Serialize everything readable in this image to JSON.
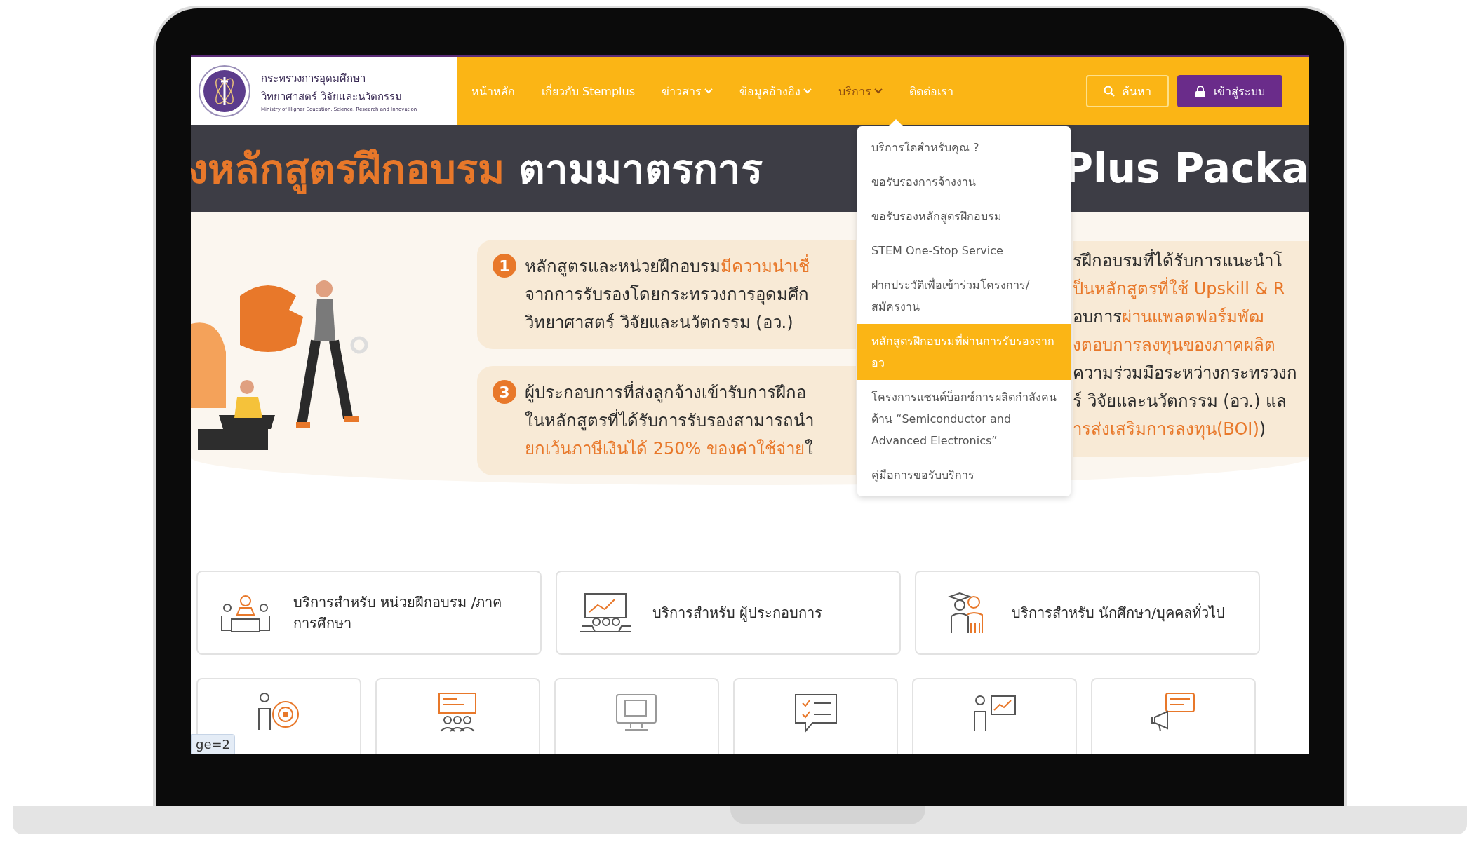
{
  "logo": {
    "line_1": "กระทรวงการอุดมศึกษา",
    "line_2": "วิทยาศาสตร์ วิจัยและนวัตกรรม",
    "line_3": "Ministry of Higher Education, Science, Research and Innovation"
  },
  "nav": [
    {
      "label": "หน้าหลัก",
      "dropdown": false,
      "selected": false
    },
    {
      "label": "เกี่ยวกับ Stemplus",
      "dropdown": false,
      "selected": false
    },
    {
      "label": "ข่าวสาร",
      "dropdown": true,
      "selected": false
    },
    {
      "label": "ข้อมูลอ้างอิง",
      "dropdown": true,
      "selected": false
    },
    {
      "label": "บริการ",
      "dropdown": true,
      "selected": true
    },
    {
      "label": "ติดต่อเรา",
      "dropdown": false,
      "selected": false
    }
  ],
  "search_button": "ค้นหา",
  "login_button": "เข้าสู่ระบบ",
  "banner": {
    "title": [
      {
        "text": "งหลักสูตรฝึกอบรม",
        "highlight": true
      },
      {
        "text": " ตามมาตรการ",
        "highlight": false
      }
    ],
    "title_right": "Plus Packa"
  },
  "points": [
    {
      "number": "1",
      "lines": [
        [
          {
            "text": "หลักสูตรและหน่วยฝึกอบรม",
            "highlight": false
          },
          {
            "text": "มีความน่าเชื่",
            "highlight": true
          }
        ],
        [
          {
            "text": "จากการรับรองโดยกระทรวงการอุดมศึก",
            "highlight": false
          }
        ],
        [
          {
            "text": "วิทยาศาสตร์ วิจัยและนวัตกรรม (อว.)",
            "highlight": false
          }
        ]
      ]
    },
    {
      "number": "3",
      "lines": [
        [
          {
            "text": "ผู้ประกอบการที่ส่งลูกจ้างเข้ารับการฝึกอ",
            "highlight": false
          }
        ],
        [
          {
            "text": "ในหลักสูตรที่ได้รับการรับรองสามารถนำ",
            "highlight": false
          }
        ],
        [
          {
            "text": "ยกเว้นภาษีเงินได้  250% ของค่าใช้จ่าย",
            "highlight": true
          },
          {
            "text": "ใ",
            "highlight": false
          }
        ]
      ]
    }
  ],
  "right_text": [
    [
      {
        "text": "รฝึกอบรมที่ได้รับการแนะนำโ",
        "highlight": false
      }
    ],
    [
      {
        "text": "ป็นหลักสูตรที่ใช้ Upskill & R",
        "highlight": true
      }
    ],
    [
      {
        "text": "อบการ",
        "highlight": false
      },
      {
        "text": "ผ่านแพลตฟอร์มพัฒ",
        "highlight": true
      }
    ],
    [
      {
        "text": "งตอบการลงทุนของภาคผลิต",
        "highlight": true
      }
    ],
    [
      {
        "text": "ความร่วมมือระหว่างกระทรวงก",
        "highlight": false
      }
    ],
    [
      {
        "text": "ร์ วิจัยและนวัตกรรม (อว.) แล",
        "highlight": false
      }
    ],
    [
      {
        "text": "ารส่งเสริมการลงทุน(BOI)",
        "highlight": true
      },
      {
        "text": ")",
        "highlight": false
      }
    ]
  ],
  "dropdown": {
    "items": [
      {
        "label": "บริการใดสำหรับคุณ ?",
        "selected": false
      },
      {
        "label": "ขอรับรองการจ้างงาน",
        "selected": false
      },
      {
        "label": "ขอรับรองหลักสูตรฝึกอบรม",
        "selected": false
      },
      {
        "label": "STEM One-Stop Service",
        "selected": false
      },
      {
        "label": "ฝากประวัติเพื่อเข้าร่วมโครงการ/สมัครงาน",
        "selected": false
      },
      {
        "label": "หลักสูตรฝึกอบรมที่ผ่านการรับรองจาก อว",
        "selected": true
      },
      {
        "label": "โครงการแซนด์บ็อกซ์การผลิตกำลังคนด้าน “Semiconductor and Advanced Electronics”",
        "selected": false
      },
      {
        "label": "คู่มือการขอรับบริการ",
        "selected": false
      }
    ]
  },
  "service_cards": [
    {
      "label": "บริการสำหรับ หน่วยฝึกอบรม /ภาคการศึกษา"
    },
    {
      "label": "บริการสำหรับ ผู้ประกอบการ"
    },
    {
      "label": "บริการสำหรับ นักศึกษา/บุคคลทั่วไป"
    }
  ],
  "status_tooltip": "ge=2"
}
